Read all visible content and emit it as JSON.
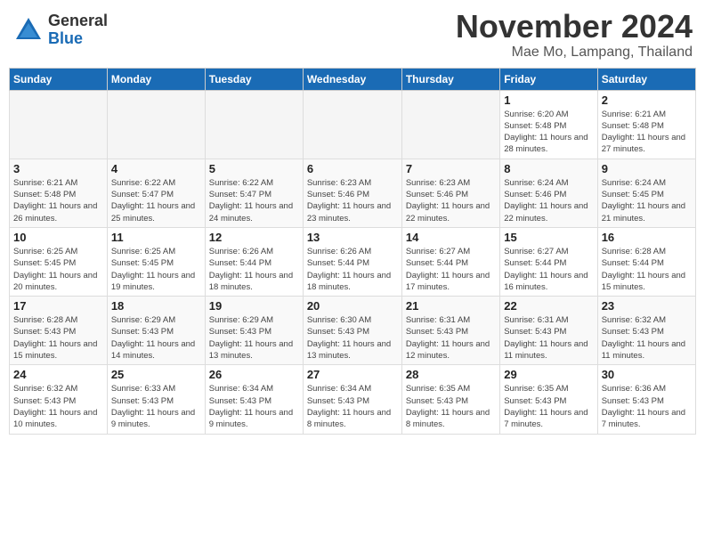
{
  "logo": {
    "general": "General",
    "blue": "Blue"
  },
  "title": "November 2024",
  "location": "Mae Mo, Lampang, Thailand",
  "days_of_week": [
    "Sunday",
    "Monday",
    "Tuesday",
    "Wednesday",
    "Thursday",
    "Friday",
    "Saturday"
  ],
  "weeks": [
    [
      {
        "day": "",
        "info": ""
      },
      {
        "day": "",
        "info": ""
      },
      {
        "day": "",
        "info": ""
      },
      {
        "day": "",
        "info": ""
      },
      {
        "day": "",
        "info": ""
      },
      {
        "day": "1",
        "info": "Sunrise: 6:20 AM\nSunset: 5:48 PM\nDaylight: 11 hours and 28 minutes."
      },
      {
        "day": "2",
        "info": "Sunrise: 6:21 AM\nSunset: 5:48 PM\nDaylight: 11 hours and 27 minutes."
      }
    ],
    [
      {
        "day": "3",
        "info": "Sunrise: 6:21 AM\nSunset: 5:48 PM\nDaylight: 11 hours and 26 minutes."
      },
      {
        "day": "4",
        "info": "Sunrise: 6:22 AM\nSunset: 5:47 PM\nDaylight: 11 hours and 25 minutes."
      },
      {
        "day": "5",
        "info": "Sunrise: 6:22 AM\nSunset: 5:47 PM\nDaylight: 11 hours and 24 minutes."
      },
      {
        "day": "6",
        "info": "Sunrise: 6:23 AM\nSunset: 5:46 PM\nDaylight: 11 hours and 23 minutes."
      },
      {
        "day": "7",
        "info": "Sunrise: 6:23 AM\nSunset: 5:46 PM\nDaylight: 11 hours and 22 minutes."
      },
      {
        "day": "8",
        "info": "Sunrise: 6:24 AM\nSunset: 5:46 PM\nDaylight: 11 hours and 22 minutes."
      },
      {
        "day": "9",
        "info": "Sunrise: 6:24 AM\nSunset: 5:45 PM\nDaylight: 11 hours and 21 minutes."
      }
    ],
    [
      {
        "day": "10",
        "info": "Sunrise: 6:25 AM\nSunset: 5:45 PM\nDaylight: 11 hours and 20 minutes."
      },
      {
        "day": "11",
        "info": "Sunrise: 6:25 AM\nSunset: 5:45 PM\nDaylight: 11 hours and 19 minutes."
      },
      {
        "day": "12",
        "info": "Sunrise: 6:26 AM\nSunset: 5:44 PM\nDaylight: 11 hours and 18 minutes."
      },
      {
        "day": "13",
        "info": "Sunrise: 6:26 AM\nSunset: 5:44 PM\nDaylight: 11 hours and 18 minutes."
      },
      {
        "day": "14",
        "info": "Sunrise: 6:27 AM\nSunset: 5:44 PM\nDaylight: 11 hours and 17 minutes."
      },
      {
        "day": "15",
        "info": "Sunrise: 6:27 AM\nSunset: 5:44 PM\nDaylight: 11 hours and 16 minutes."
      },
      {
        "day": "16",
        "info": "Sunrise: 6:28 AM\nSunset: 5:44 PM\nDaylight: 11 hours and 15 minutes."
      }
    ],
    [
      {
        "day": "17",
        "info": "Sunrise: 6:28 AM\nSunset: 5:43 PM\nDaylight: 11 hours and 15 minutes."
      },
      {
        "day": "18",
        "info": "Sunrise: 6:29 AM\nSunset: 5:43 PM\nDaylight: 11 hours and 14 minutes."
      },
      {
        "day": "19",
        "info": "Sunrise: 6:29 AM\nSunset: 5:43 PM\nDaylight: 11 hours and 13 minutes."
      },
      {
        "day": "20",
        "info": "Sunrise: 6:30 AM\nSunset: 5:43 PM\nDaylight: 11 hours and 13 minutes."
      },
      {
        "day": "21",
        "info": "Sunrise: 6:31 AM\nSunset: 5:43 PM\nDaylight: 11 hours and 12 minutes."
      },
      {
        "day": "22",
        "info": "Sunrise: 6:31 AM\nSunset: 5:43 PM\nDaylight: 11 hours and 11 minutes."
      },
      {
        "day": "23",
        "info": "Sunrise: 6:32 AM\nSunset: 5:43 PM\nDaylight: 11 hours and 11 minutes."
      }
    ],
    [
      {
        "day": "24",
        "info": "Sunrise: 6:32 AM\nSunset: 5:43 PM\nDaylight: 11 hours and 10 minutes."
      },
      {
        "day": "25",
        "info": "Sunrise: 6:33 AM\nSunset: 5:43 PM\nDaylight: 11 hours and 9 minutes."
      },
      {
        "day": "26",
        "info": "Sunrise: 6:34 AM\nSunset: 5:43 PM\nDaylight: 11 hours and 9 minutes."
      },
      {
        "day": "27",
        "info": "Sunrise: 6:34 AM\nSunset: 5:43 PM\nDaylight: 11 hours and 8 minutes."
      },
      {
        "day": "28",
        "info": "Sunrise: 6:35 AM\nSunset: 5:43 PM\nDaylight: 11 hours and 8 minutes."
      },
      {
        "day": "29",
        "info": "Sunrise: 6:35 AM\nSunset: 5:43 PM\nDaylight: 11 hours and 7 minutes."
      },
      {
        "day": "30",
        "info": "Sunrise: 6:36 AM\nSunset: 5:43 PM\nDaylight: 11 hours and 7 minutes."
      }
    ]
  ]
}
